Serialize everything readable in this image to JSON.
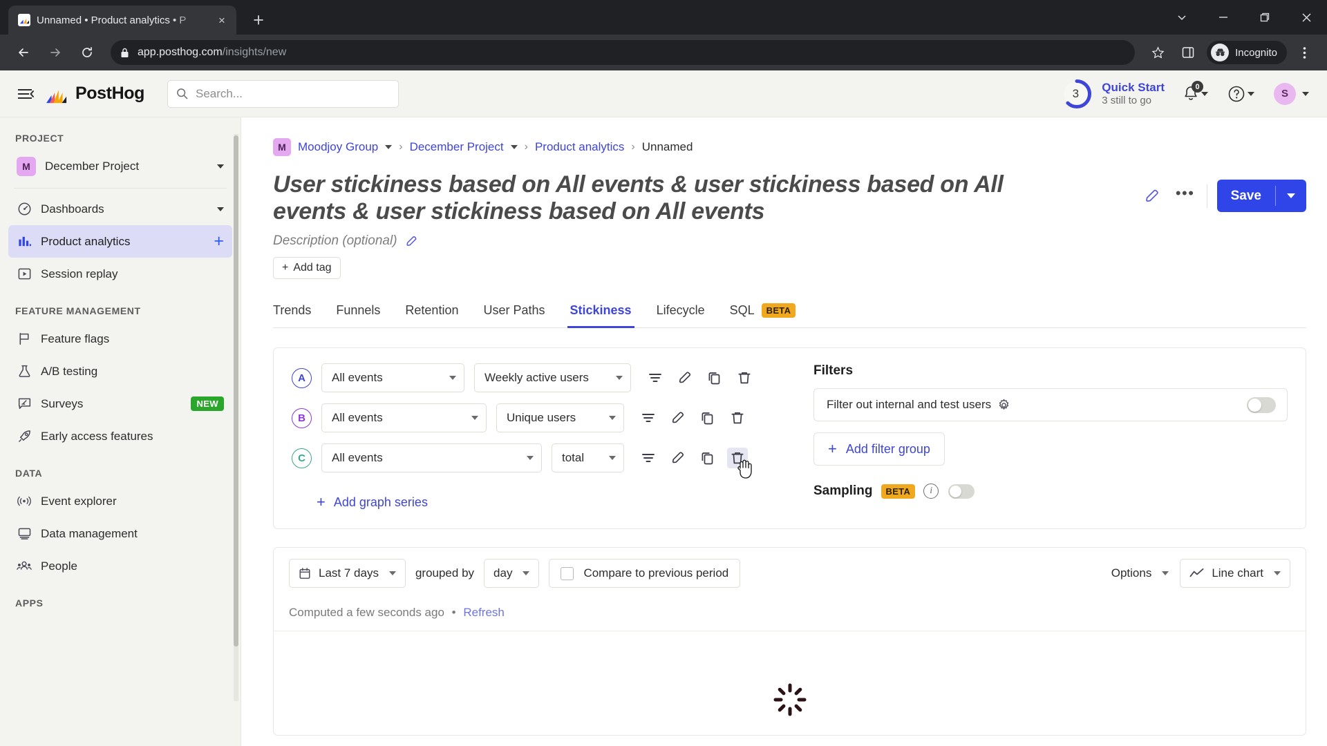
{
  "browser": {
    "tab": {
      "title": "Unnamed • Product analytics • P",
      "favicon_name": "posthog-favicon",
      "close_label": "×"
    },
    "newtab_label": "+",
    "window_controls": [
      "chevron-down",
      "minimize",
      "maximize",
      "close"
    ],
    "url_bold": "app.posthog.com",
    "url_dim": "/insights/new",
    "incognito_label": "Incognito"
  },
  "topbar": {
    "brand": "PostHog",
    "search_placeholder": "Search...",
    "quick_start": {
      "count": "3",
      "title": "Quick Start",
      "subtitle": "3 still to go"
    },
    "notifications_badge": "0",
    "avatar_initial": "S"
  },
  "sidebar": {
    "sections": [
      {
        "label": "PROJECT",
        "items": [
          {
            "label": "December Project",
            "icon": "project-badge-m",
            "badge_text": "M",
            "trailing": "caret"
          }
        ]
      },
      {
        "label": "",
        "items": [
          {
            "label": "Dashboards",
            "icon": "gauge-icon",
            "trailing": "caret"
          },
          {
            "label": "Product analytics",
            "icon": "bar-chart-icon",
            "active": true,
            "trailing": "plus"
          },
          {
            "label": "Session replay",
            "icon": "play-box-icon"
          }
        ]
      },
      {
        "label": "FEATURE MANAGEMENT",
        "items": [
          {
            "label": "Feature flags",
            "icon": "flag-icon"
          },
          {
            "label": "A/B testing",
            "icon": "flask-icon"
          },
          {
            "label": "Surveys",
            "icon": "survey-icon",
            "badge": "NEW"
          },
          {
            "label": "Early access features",
            "icon": "rocket-icon"
          }
        ]
      },
      {
        "label": "DATA",
        "items": [
          {
            "label": "Event explorer",
            "icon": "signal-icon"
          },
          {
            "label": "Data management",
            "icon": "monitor-icon"
          },
          {
            "label": "People",
            "icon": "people-icon"
          }
        ]
      },
      {
        "label": "APPS",
        "items": []
      }
    ]
  },
  "breadcrumb": {
    "org_badge": "M",
    "items": [
      {
        "label": "Moodjoy Group",
        "link": true,
        "caret": true
      },
      {
        "label": "December Project",
        "link": true,
        "caret": true
      },
      {
        "label": "Product analytics",
        "link": true,
        "caret": false
      },
      {
        "label": "Unnamed",
        "link": false,
        "caret": false
      }
    ],
    "separator": "›"
  },
  "insight": {
    "title": "User stickiness based on All events & user stickiness based on All events & user stickiness based on All events",
    "description_placeholder": "Description (optional)",
    "add_tag_label": "Add tag",
    "add_tag_plus": "+",
    "save_label": "Save",
    "edit_icon": "pencil-icon",
    "more_icon": "ellipsis-icon"
  },
  "tabs": [
    {
      "label": "Trends",
      "selected": false
    },
    {
      "label": "Funnels",
      "selected": false
    },
    {
      "label": "Retention",
      "selected": false
    },
    {
      "label": "User Paths",
      "selected": false
    },
    {
      "label": "Stickiness",
      "selected": true
    },
    {
      "label": "Lifecycle",
      "selected": false
    },
    {
      "label": "SQL",
      "selected": false,
      "badge": "BETA"
    }
  ],
  "series": [
    {
      "letter": "A",
      "color": "#3e45d8",
      "event": "All events",
      "math": "Weekly active users",
      "event_width": 207,
      "math_width": 227,
      "icons": [
        "filter-icon",
        "pencil-icon",
        "duplicate-icon",
        "trash-icon"
      ]
    },
    {
      "letter": "B",
      "color": "#8c38d8",
      "event": "All events",
      "math": "Unique users",
      "event_width": 239,
      "math_width": 185,
      "icons": [
        "filter-icon",
        "pencil-icon",
        "duplicate-icon",
        "trash-icon"
      ]
    },
    {
      "letter": "C",
      "color": "#3aa88a",
      "event": "All events",
      "math": "total",
      "event_width": 319,
      "math_width": 105,
      "icons": [
        "filter-icon",
        "pencil-icon",
        "duplicate-icon",
        "trash-icon"
      ],
      "hovered_icon_index": 3
    }
  ],
  "add_series_label": "Add graph series",
  "add_series_plus": "+",
  "filters": {
    "title": "Filters",
    "internal_users_label": "Filter out internal and test users",
    "gear_icon": "gear-icon",
    "internal_users_toggle": false,
    "add_filter_group_label": "Add filter group",
    "add_filter_group_plus": "+",
    "sampling_label": "Sampling",
    "sampling_badge": "BETA",
    "sampling_info_icon": "info-icon",
    "sampling_toggle": false
  },
  "results_toolbar": {
    "date_range": "Last 7 days",
    "calendar_icon": "calendar-icon",
    "grouped_by_label": "grouped by",
    "interval": "day",
    "compare_label": "Compare to previous period",
    "compare_checked": false,
    "options_label": "Options",
    "chart_type": "Line chart",
    "chart_type_icon": "line-chart-icon"
  },
  "computed": {
    "text": "Computed a few seconds ago",
    "bullet": "•",
    "refresh_label": "Refresh"
  },
  "colors": {
    "accent": "#3e45d8",
    "save_button": "#2f45e8",
    "active_sidebar": "#dcdcf7",
    "badge_new": "#2aa62a",
    "badge_beta": "#f0a81e",
    "avatar": "#eab8f0"
  }
}
